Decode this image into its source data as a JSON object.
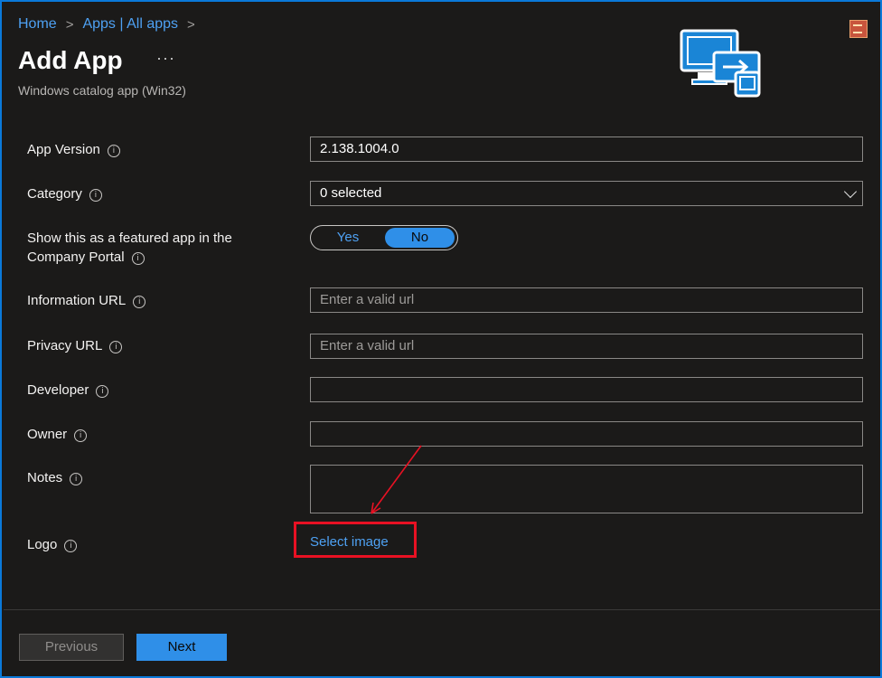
{
  "breadcrumb": {
    "home": "Home",
    "apps": "Apps | All apps",
    "separator": ">"
  },
  "header": {
    "title": "Add App",
    "more": "···",
    "subtitle": "Windows catalog app (Win32)"
  },
  "form": {
    "app_version": {
      "label": "App Version",
      "value": "2.138.1004.0"
    },
    "category": {
      "label": "Category",
      "value": "0 selected"
    },
    "featured": {
      "label_line1": "Show this as a featured app in the",
      "label_line2": "Company Portal",
      "yes": "Yes",
      "no": "No",
      "selected": "No"
    },
    "information_url": {
      "label": "Information URL",
      "placeholder": "Enter a valid url"
    },
    "privacy_url": {
      "label": "Privacy URL",
      "placeholder": "Enter a valid url"
    },
    "developer": {
      "label": "Developer",
      "value": ""
    },
    "owner": {
      "label": "Owner",
      "value": ""
    },
    "notes": {
      "label": "Notes",
      "value": ""
    },
    "logo": {
      "label": "Logo",
      "action": "Select image"
    }
  },
  "info_glyph": "i",
  "footer": {
    "previous": "Previous",
    "next": "Next"
  },
  "icons": {
    "app": "remote-desktop-icon",
    "info": "info-icon",
    "chevron": "chevron-down-icon"
  },
  "colors": {
    "accent": "#2f8fe8",
    "link": "#4ea1f3",
    "highlight": "#e81123",
    "background": "#1b1a19"
  }
}
